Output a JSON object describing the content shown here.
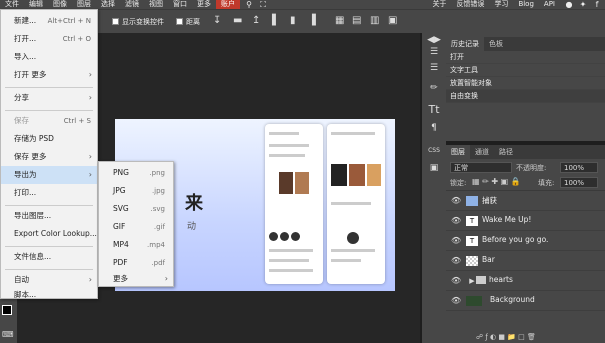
{
  "menubar": {
    "items": [
      "文件",
      "编辑",
      "图像",
      "图层",
      "选择",
      "滤镜",
      "视图",
      "窗口",
      "更多",
      "账户"
    ],
    "right_items": [
      "关于",
      "反馈错误",
      "学习",
      "Blog",
      "API"
    ]
  },
  "optbar": {
    "show_transform": "显示变换控件",
    "distance": "距离"
  },
  "file_menu": {
    "new": {
      "label": "新建...",
      "shortcut": "Alt+Ctrl + N"
    },
    "open": {
      "label": "打开...",
      "shortcut": "Ctrl + O"
    },
    "import": {
      "label": "导入..."
    },
    "open_more": {
      "label": "打开 更多"
    },
    "share": {
      "label": "分享"
    },
    "save": {
      "label": "保存",
      "shortcut": "Ctrl + S"
    },
    "save_psd": {
      "label": "存储为 PSD"
    },
    "save_more": {
      "label": "保存 更多"
    },
    "export_as": {
      "label": "导出为"
    },
    "print": {
      "label": "打印..."
    },
    "export_layers": {
      "label": "导出图层..."
    },
    "export_color": {
      "label": "Export Color Lookup..."
    },
    "file_info": {
      "label": "文件信息..."
    },
    "automate": {
      "label": "自动"
    },
    "script": {
      "label": "脚本..."
    }
  },
  "export_submenu": [
    {
      "label": "PNG",
      "ext": ".png"
    },
    {
      "label": "JPG",
      "ext": ".jpg"
    },
    {
      "label": "SVG",
      "ext": ".svg"
    },
    {
      "label": "GIF",
      "ext": ".gif"
    },
    {
      "label": "MP4",
      "ext": ".mp4"
    },
    {
      "label": "PDF",
      "ext": ".pdf"
    },
    {
      "label": "更多",
      "ext": ""
    }
  ],
  "artwork": {
    "title": "来",
    "subtitle": "动"
  },
  "history_panel": {
    "tabs": [
      "历史记录",
      "色板"
    ],
    "items": [
      "打开",
      "文字工具",
      "放置智能对象",
      "自由变换"
    ]
  },
  "layers_panel": {
    "tabs": [
      "图层",
      "通道",
      "路径"
    ],
    "blend_mode": "正常",
    "opacity_label": "不透明度:",
    "opacity_value": "100%",
    "lock_label": "锁定:",
    "fill_label": "填充:",
    "fill_value": "100%",
    "layers": [
      {
        "name": "捕获",
        "thumb": ""
      },
      {
        "name": "Wake Me Up!",
        "thumb": "T"
      },
      {
        "name": "Before you go go.",
        "thumb": "T"
      },
      {
        "name": "Bar",
        "thumb": ""
      },
      {
        "name": "hearts",
        "thumb": ""
      },
      {
        "name": "Background",
        "thumb": ""
      }
    ]
  }
}
